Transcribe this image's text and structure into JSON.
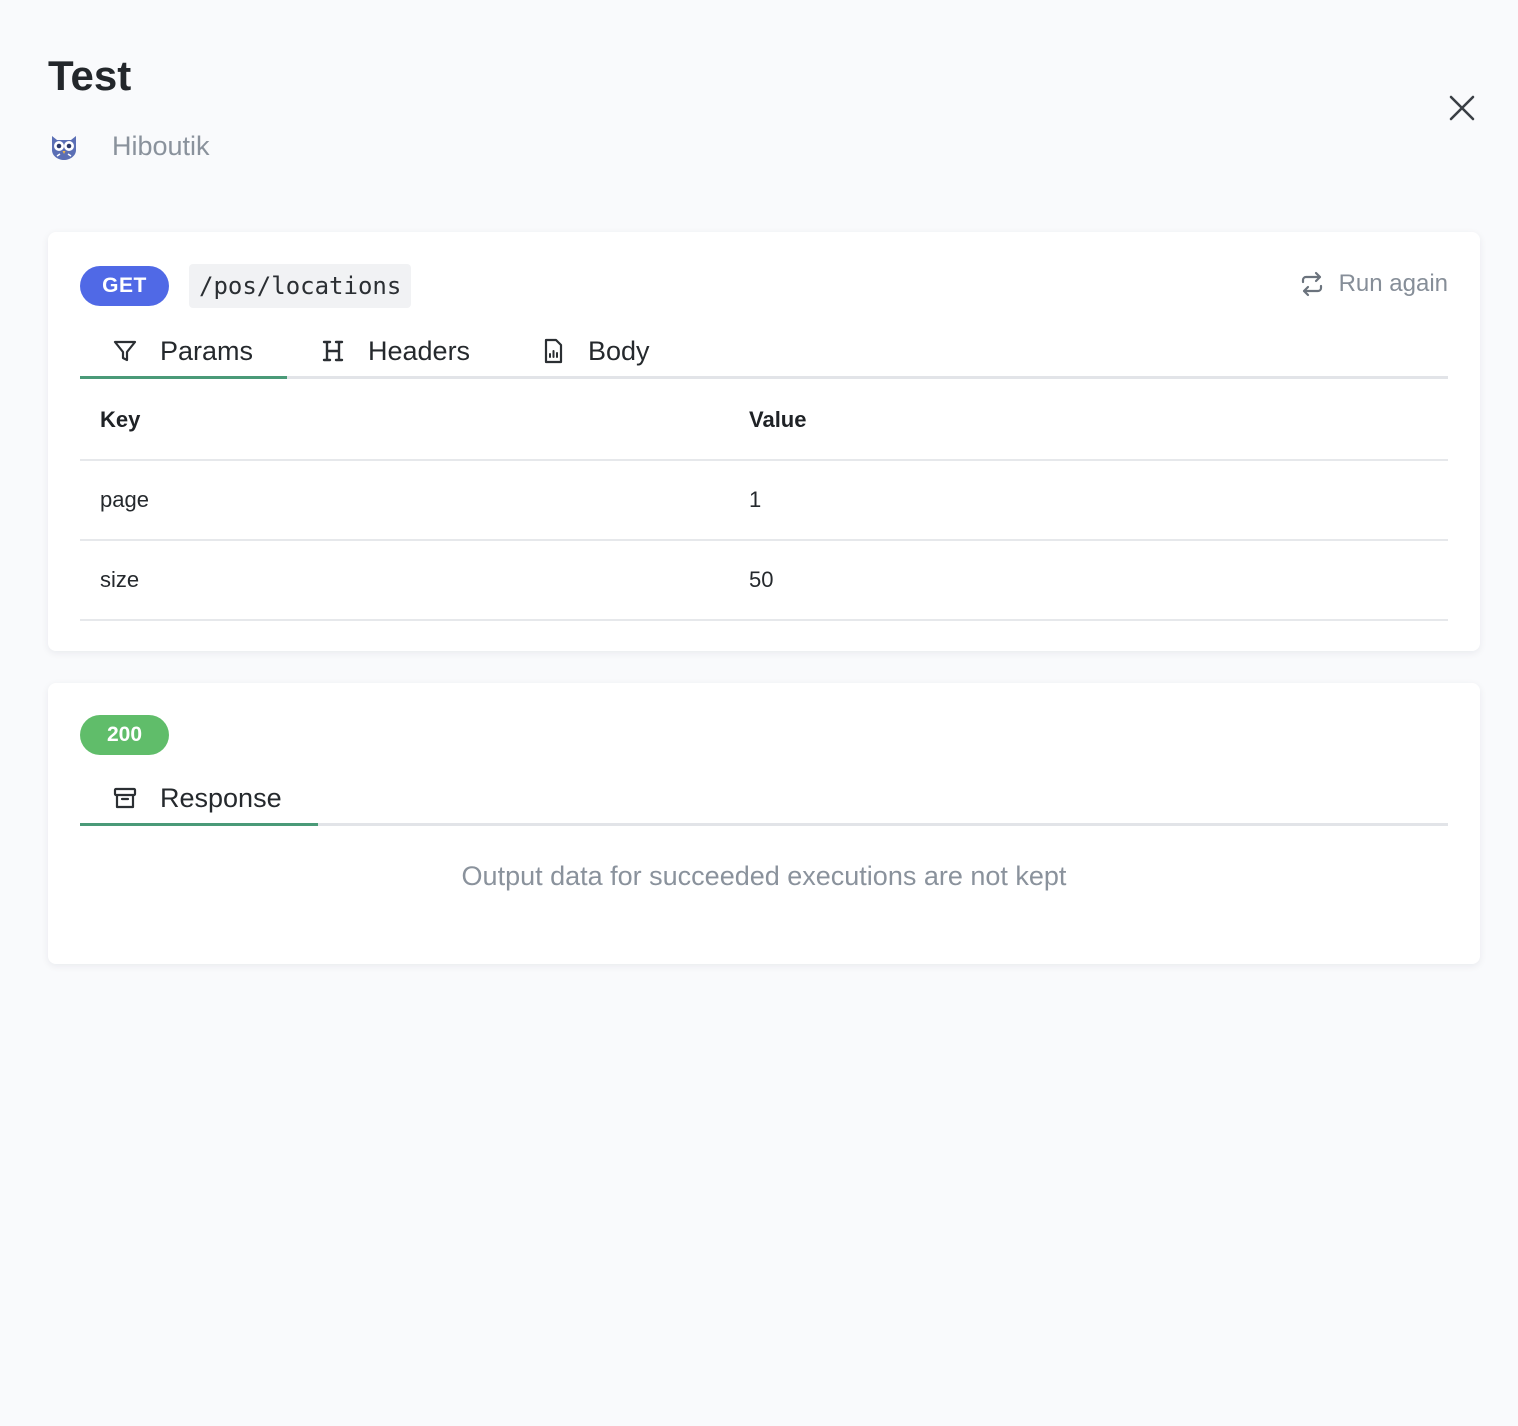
{
  "header": {
    "title": "Test",
    "connector_name": "Hiboutik",
    "connector_icon": "owl-icon",
    "close_icon": "close-icon"
  },
  "request": {
    "method": "GET",
    "method_color": "#5069e6",
    "path": "/pos/locations",
    "run_again_label": "Run again",
    "run_again_icon": "repeat-icon",
    "tabs": [
      {
        "label": "Params",
        "icon": "filter-icon",
        "active": true
      },
      {
        "label": "Headers",
        "icon": "heading-icon",
        "active": false
      },
      {
        "label": "Body",
        "icon": "file-chart-icon",
        "active": false
      }
    ],
    "table": {
      "columns": [
        "Key",
        "Value"
      ],
      "rows": [
        {
          "key": "page",
          "value": "1"
        },
        {
          "key": "size",
          "value": "50"
        }
      ]
    }
  },
  "response": {
    "status": "200",
    "status_color": "#60bd6a",
    "tabs": [
      {
        "label": "Response",
        "icon": "archive-icon",
        "active": true
      }
    ],
    "empty_message": "Output data for succeeded executions are not kept"
  },
  "colors": {
    "active_tab_indicator": "#4a9a78",
    "background": "#f9fafc"
  }
}
